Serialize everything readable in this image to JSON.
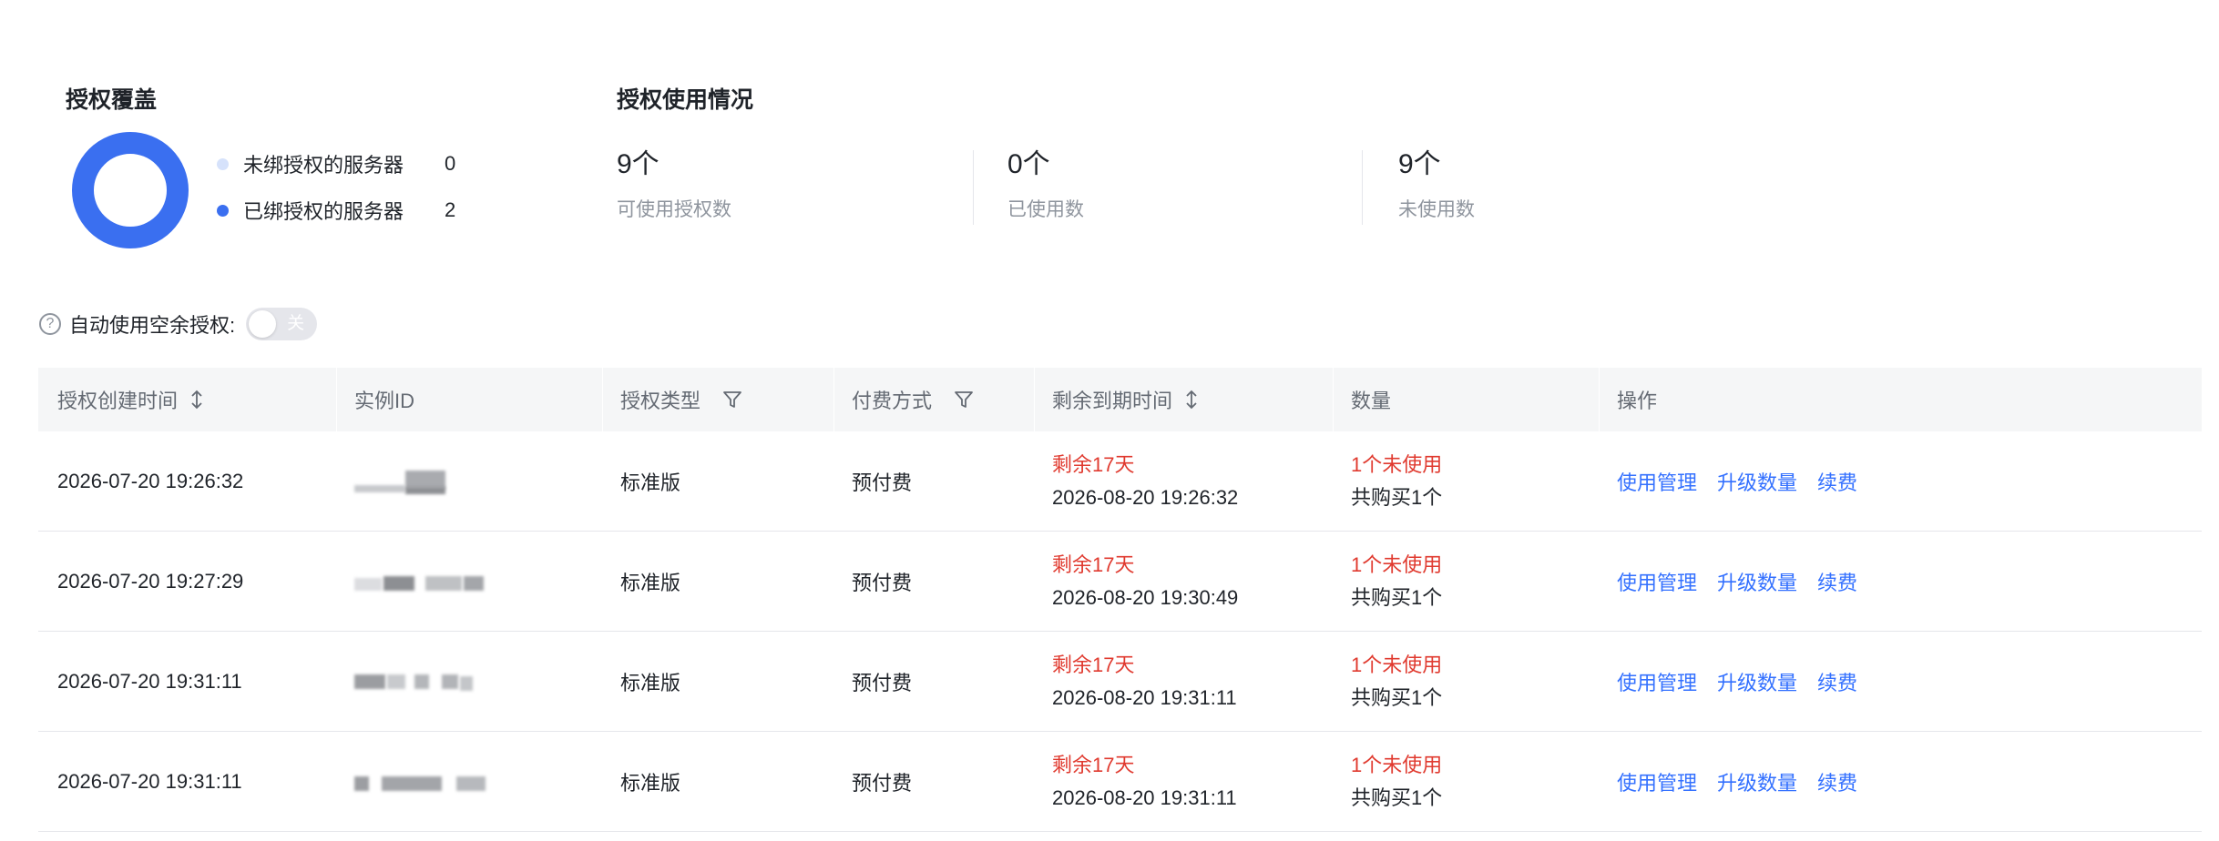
{
  "coverage": {
    "title": "授权覆盖",
    "legend": [
      {
        "label": "未绑授权的服务器",
        "count": "0",
        "color": "#d6e2fb"
      },
      {
        "label": "已绑授权的服务器",
        "count": "2",
        "color": "#3a6ff0"
      }
    ]
  },
  "usage": {
    "title": "授权使用情况",
    "stats": [
      {
        "value": "9个",
        "label": "可使用授权数"
      },
      {
        "value": "0个",
        "label": "已使用数"
      },
      {
        "value": "9个",
        "label": "未使用数"
      }
    ]
  },
  "auto_use": {
    "label": "自动使用空余授权:",
    "toggle_text": "关",
    "enabled": false
  },
  "table": {
    "columns": [
      {
        "label": "授权创建时间",
        "icon": "sort-icon"
      },
      {
        "label": "实例ID",
        "icon": ""
      },
      {
        "label": "授权类型",
        "icon": "filter-icon"
      },
      {
        "label": "付费方式",
        "icon": "filter-icon"
      },
      {
        "label": "剩余到期时间",
        "icon": "sort-icon"
      },
      {
        "label": "数量",
        "icon": ""
      },
      {
        "label": "操作",
        "icon": ""
      }
    ],
    "rows": [
      {
        "created": "2026-07-20 19:26:32",
        "type": "标准版",
        "pay": "预付费",
        "remaining": "剩余17天",
        "expire": "2026-08-20 19:26:32",
        "unused": "1个未使用",
        "total": "共购买1个",
        "actions": [
          "使用管理",
          "升级数量",
          "续费"
        ]
      },
      {
        "created": "2026-07-20 19:27:29",
        "type": "标准版",
        "pay": "预付费",
        "remaining": "剩余17天",
        "expire": "2026-08-20 19:30:49",
        "unused": "1个未使用",
        "total": "共购买1个",
        "actions": [
          "使用管理",
          "升级数量",
          "续费"
        ]
      },
      {
        "created": "2026-07-20 19:31:11",
        "type": "标准版",
        "pay": "预付费",
        "remaining": "剩余17天",
        "expire": "2026-08-20 19:31:11",
        "unused": "1个未使用",
        "total": "共购买1个",
        "actions": [
          "使用管理",
          "升级数量",
          "续费"
        ]
      },
      {
        "created": "2026-07-20 19:31:11",
        "type": "标准版",
        "pay": "预付费",
        "remaining": "剩余17天",
        "expire": "2026-08-20 19:31:11",
        "unused": "1个未使用",
        "total": "共购买1个",
        "actions": [
          "使用管理",
          "升级数量",
          "续费"
        ]
      }
    ]
  }
}
